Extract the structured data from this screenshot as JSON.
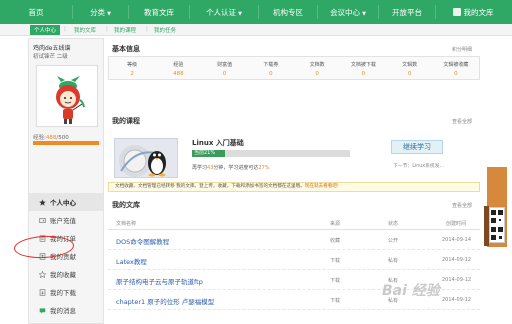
{
  "topnav": {
    "items": [
      "首页",
      "分类",
      "教育文库",
      "个人认证",
      "机构专区",
      "会议中心",
      "开放平台",
      "我的文库"
    ]
  },
  "subnav": {
    "tabs": [
      "个人中心",
      "我的文库",
      "我的课程",
      "我的任务"
    ]
  },
  "profile": {
    "name": "鸡肉de五线谱",
    "level": "初试锋芒 二级",
    "exp_label": "经验:",
    "exp_current": "488",
    "exp_max": "/500",
    "exp_fraction": 0.976
  },
  "menu": {
    "items": [
      {
        "label": "个人中心",
        "icon": "star-icon",
        "active": true
      },
      {
        "label": "账户充值",
        "icon": "wallet-icon",
        "active": false
      },
      {
        "label": "我的订单",
        "icon": "order-icon",
        "active": false
      },
      {
        "label": "我的贡献",
        "icon": "upload-icon",
        "active": false
      },
      {
        "label": "我的收藏",
        "icon": "star-outline-icon",
        "active": false
      },
      {
        "label": "我的下载",
        "icon": "download-icon",
        "active": false
      },
      {
        "label": "我的消息",
        "icon": "message-icon",
        "active": false
      }
    ]
  },
  "basic_info": {
    "title": "基本信息",
    "more": "积分明细",
    "stats": [
      {
        "label": "等级",
        "value": "2"
      },
      {
        "label": "经验",
        "value": "488"
      },
      {
        "label": "财富值",
        "value": "0"
      },
      {
        "label": "下载券",
        "value": "0"
      },
      {
        "label": "文档数",
        "value": "0"
      },
      {
        "label": "文档被下载",
        "value": "0"
      },
      {
        "label": "文辑数",
        "value": "0"
      },
      {
        "label": "文辑被收藏",
        "value": "0"
      }
    ]
  },
  "courses": {
    "title": "我的课程",
    "more": "查看全部",
    "course_title": "Linux 入门基础",
    "progress_label": "当前21%",
    "progress_fraction": 0.21,
    "meta_prefix": "再学习",
    "meta_count": "43",
    "meta_mid": "分钟，学习进度可达",
    "meta_pct": "27%",
    "button": "继续学习",
    "next": "下一节：Linux系统发..."
  },
  "notice": {
    "text": "文档收藏、文档管理已经转移 我的文库。登上传，收藏，下载和添加书签的文档都在这里哦。",
    "link": "现在就去看看吧!"
  },
  "library": {
    "title": "我的文库",
    "more": "查看全部",
    "headers": {
      "name": "文档名称",
      "source": "来源",
      "status": "状态",
      "date": "创建时间"
    },
    "rows": [
      {
        "name": "DOS命令图解教程",
        "source": "收藏",
        "status": "公开",
        "date": "2014-09-14"
      },
      {
        "name": "Latex教程",
        "source": "下载",
        "status": "私有",
        "date": "2014-09-12"
      },
      {
        "name": "原子结构电子云与原子轨道ftp",
        "source": "下载",
        "status": "私有",
        "date": "2014-09-12"
      },
      {
        "name": "chapter1 原子的位形 卢瑟福模型",
        "source": "下载",
        "status": "私有",
        "date": "2014-09-12"
      }
    ]
  },
  "watermark": "Bai 经验",
  "colors": {
    "brand": "#2fa866",
    "accent": "#f08a24",
    "link": "#2a5db0",
    "annotation": "#e02a2a"
  }
}
